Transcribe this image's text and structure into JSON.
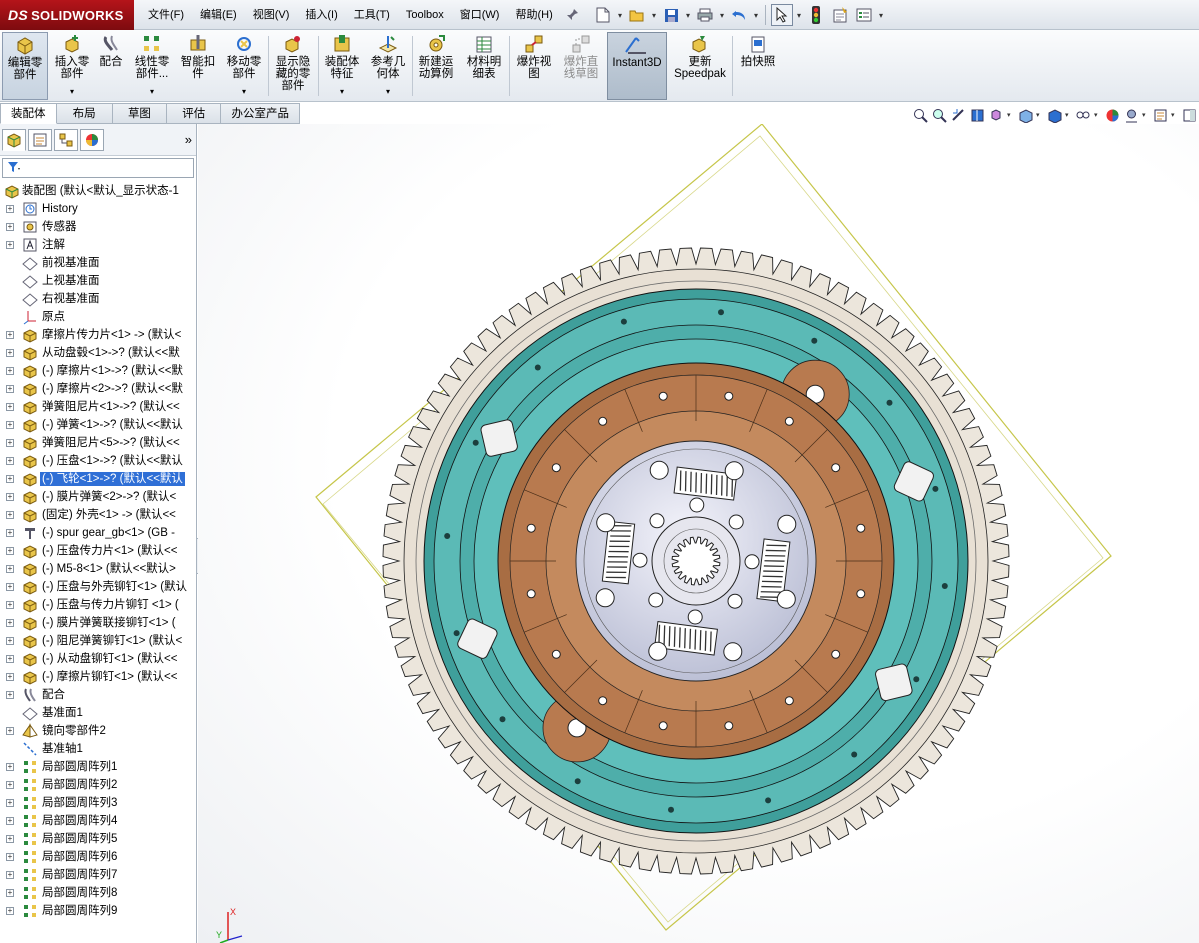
{
  "app": {
    "logo_mark": "DS",
    "logo_text": "SOLIDWORKS"
  },
  "menu": [
    {
      "label": "文件(F)"
    },
    {
      "label": "编辑(E)"
    },
    {
      "label": "视图(V)"
    },
    {
      "label": "插入(I)"
    },
    {
      "label": "工具(T)"
    },
    {
      "label": "Toolbox"
    },
    {
      "label": "窗口(W)"
    },
    {
      "label": "帮助(H)"
    }
  ],
  "ribbon": {
    "buttons": [
      {
        "label": "编辑零\n部件",
        "icon": "edit-component-icon"
      },
      {
        "label": "插入零\n部件",
        "icon": "insert-components-icon"
      },
      {
        "label": "配合",
        "icon": "mate-icon"
      },
      {
        "label": "线性零\n部件...",
        "icon": "linear-pattern-icon"
      },
      {
        "label": "智能扣\n件",
        "icon": "smart-fasteners-icon"
      },
      {
        "label": "移动零\n部件",
        "icon": "move-component-icon"
      },
      {
        "label": "显示隐\n藏的零\n部件",
        "icon": "show-hidden-icon"
      },
      {
        "label": "装配体\n特征",
        "icon": "assembly-features-icon"
      },
      {
        "label": "参考几\n何体",
        "icon": "reference-geometry-icon"
      },
      {
        "label": "新建运\n动算例",
        "icon": "motion-study-icon"
      },
      {
        "label": "材料明\n细表",
        "icon": "bom-icon"
      },
      {
        "label": "爆炸视\n图",
        "icon": "exploded-view-icon"
      },
      {
        "label": "爆炸直\n线草图",
        "icon": "explode-line-icon"
      },
      {
        "label": "Instant3D",
        "icon": "instant3d-icon"
      },
      {
        "label": "更新\nSpeedpak",
        "icon": "speedpak-icon"
      },
      {
        "label": "拍快照",
        "icon": "snapshot-icon"
      }
    ]
  },
  "command_tabs": [
    {
      "label": "装配体"
    },
    {
      "label": "布局"
    },
    {
      "label": "草图"
    },
    {
      "label": "评估"
    },
    {
      "label": "办公室产品"
    }
  ],
  "tree": {
    "root": "装配图 (默认<默认_显示状态-1",
    "items": [
      {
        "label": "History",
        "icon": "history"
      },
      {
        "label": "传感器",
        "icon": "sensor"
      },
      {
        "label": "注解",
        "icon": "annotation"
      },
      {
        "label": "前视基准面",
        "icon": "plane"
      },
      {
        "label": "上视基准面",
        "icon": "plane"
      },
      {
        "label": "右视基准面",
        "icon": "plane"
      },
      {
        "label": "原点",
        "icon": "origin"
      },
      {
        "label": "摩擦片传力片<1> -> (默认<",
        "icon": "part"
      },
      {
        "label": "从动盘毂<1>->? (默认<<默",
        "icon": "part"
      },
      {
        "label": "(-) 摩擦片<1>->? (默认<<默",
        "icon": "part"
      },
      {
        "label": "(-) 摩擦片<2>->? (默认<<默",
        "icon": "part"
      },
      {
        "label": "弹簧阻尼片<1>->? (默认<<",
        "icon": "part"
      },
      {
        "label": "(-) 弹簧<1>->? (默认<<默认",
        "icon": "part"
      },
      {
        "label": "弹簧阻尼片<5>->? (默认<<",
        "icon": "part"
      },
      {
        "label": "(-) 压盘<1>->? (默认<<默认",
        "icon": "part"
      },
      {
        "label": "(-) 飞轮<1>->? (默认<<默认",
        "icon": "part"
      },
      {
        "label": "(-) 膜片弹簧<2>->? (默认<",
        "icon": "part"
      },
      {
        "label": "(固定) 外壳<1> -> (默认<<",
        "icon": "part"
      },
      {
        "label": "(-) spur gear_gb<1> (GB -",
        "icon": "toolbox"
      },
      {
        "label": "(-) 压盘传力片<1> (默认<<",
        "icon": "part"
      },
      {
        "label": "(-) M5-8<1> (默认<<默认>",
        "icon": "part"
      },
      {
        "label": "(-) 压盘与外壳铆钉<1> (默认",
        "icon": "part"
      },
      {
        "label": "(-) 压盘与传力片铆钉 <1> (",
        "icon": "part"
      },
      {
        "label": "(-) 膜片弹簧联接铆钉<1> (",
        "icon": "part"
      },
      {
        "label": "(-) 阻尼弹簧铆钉<1> (默认<",
        "icon": "part"
      },
      {
        "label": "(-) 从动盘铆钉<1> (默认<<",
        "icon": "part"
      },
      {
        "label": "(-) 摩擦片铆钉<1> (默认<<",
        "icon": "part"
      },
      {
        "label": "配合",
        "icon": "mates"
      },
      {
        "label": "基准面1",
        "icon": "plane"
      },
      {
        "label": "镜向零部件2",
        "icon": "mirror"
      },
      {
        "label": "基准轴1",
        "icon": "axis"
      },
      {
        "label": "局部圆周阵列1",
        "icon": "pattern"
      },
      {
        "label": "局部圆周阵列2",
        "icon": "pattern"
      },
      {
        "label": "局部圆周阵列3",
        "icon": "pattern"
      },
      {
        "label": "局部圆周阵列4",
        "icon": "pattern"
      },
      {
        "label": "局部圆周阵列5",
        "icon": "pattern"
      },
      {
        "label": "局部圆周阵列6",
        "icon": "pattern"
      },
      {
        "label": "局部圆周阵列7",
        "icon": "pattern"
      },
      {
        "label": "局部圆周阵列8",
        "icon": "pattern"
      },
      {
        "label": "局部圆周阵列9",
        "icon": "pattern"
      }
    ]
  },
  "triad": {
    "x": "X",
    "y": "Y"
  },
  "colors": {
    "accent": "#b5141a",
    "selection": "#2f6fd6",
    "flywheel": "#5bbab6",
    "friction": "#b87a4f",
    "ring_gear": "#ece6dc"
  }
}
